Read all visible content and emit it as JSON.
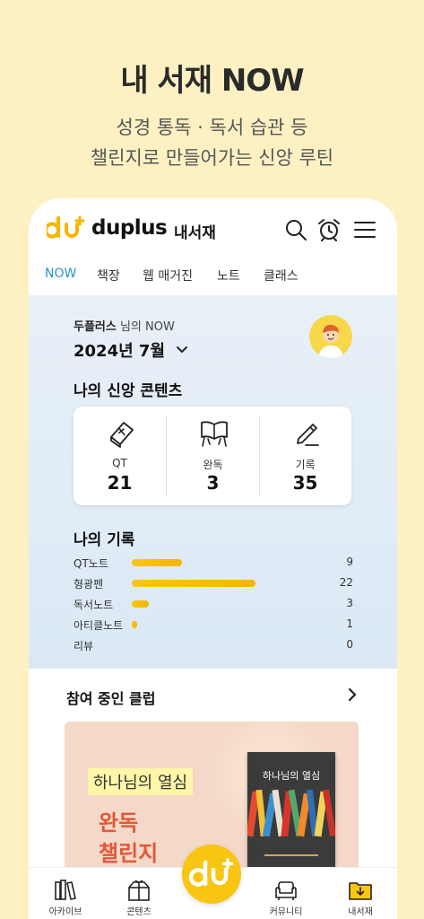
{
  "promo": {
    "title": "내 서재 NOW",
    "subtitle_line1": "성경 통독 · 독서 습관 등",
    "subtitle_line2": "챌린지로 만들어가는 신앙 루틴"
  },
  "header": {
    "logo_text": "duplus",
    "section": "내서재",
    "icons": [
      "search-icon",
      "alarm-clock-icon",
      "menu-icon"
    ]
  },
  "tabs": [
    {
      "label": "NOW",
      "active": true
    },
    {
      "label": "책장",
      "active": false
    },
    {
      "label": "웹 매거진",
      "active": false
    },
    {
      "label": "노트",
      "active": false
    },
    {
      "label": "클래스",
      "active": false
    }
  ],
  "now": {
    "owner_name": "두플러스",
    "owner_suffix": " 님의 NOW",
    "date": "2024년 7월",
    "contents_title": "나의 신앙 콘텐츠",
    "stats": [
      {
        "label": "QT",
        "value": "21",
        "icon": "bible-icon"
      },
      {
        "label": "완독",
        "value": "3",
        "icon": "open-book-icon"
      },
      {
        "label": "기록",
        "value": "35",
        "icon": "pencil-icon"
      }
    ],
    "records_title": "나의 기록",
    "records": [
      {
        "label": "QT노트",
        "value": 9
      },
      {
        "label": "형광펜",
        "value": 22
      },
      {
        "label": "독서노트",
        "value": 3
      },
      {
        "label": "아티클노트",
        "value": 1
      },
      {
        "label": "리뷰",
        "value": 0
      }
    ]
  },
  "clubs": {
    "title": "참여 중인 클럽",
    "banner": {
      "tag": "하나님의 열심",
      "title_line1": "완독",
      "title_line2": "챌린지",
      "book_title": "하나님의 열심"
    }
  },
  "colors": {
    "background": "#fdf1c4",
    "accent_yellow": "#f9c513",
    "tab_active": "#2a93d5",
    "banner_title": "#e3573a"
  },
  "bottom_nav": [
    {
      "label": "아카이브",
      "icon": "archive-icon"
    },
    {
      "label": "콘텐츠",
      "icon": "gift-box-icon"
    },
    {
      "label": "",
      "icon": "duplus-logo-icon"
    },
    {
      "label": "커뮤니티",
      "icon": "sofa-icon"
    },
    {
      "label": "내서재",
      "icon": "folder-download-icon"
    }
  ]
}
